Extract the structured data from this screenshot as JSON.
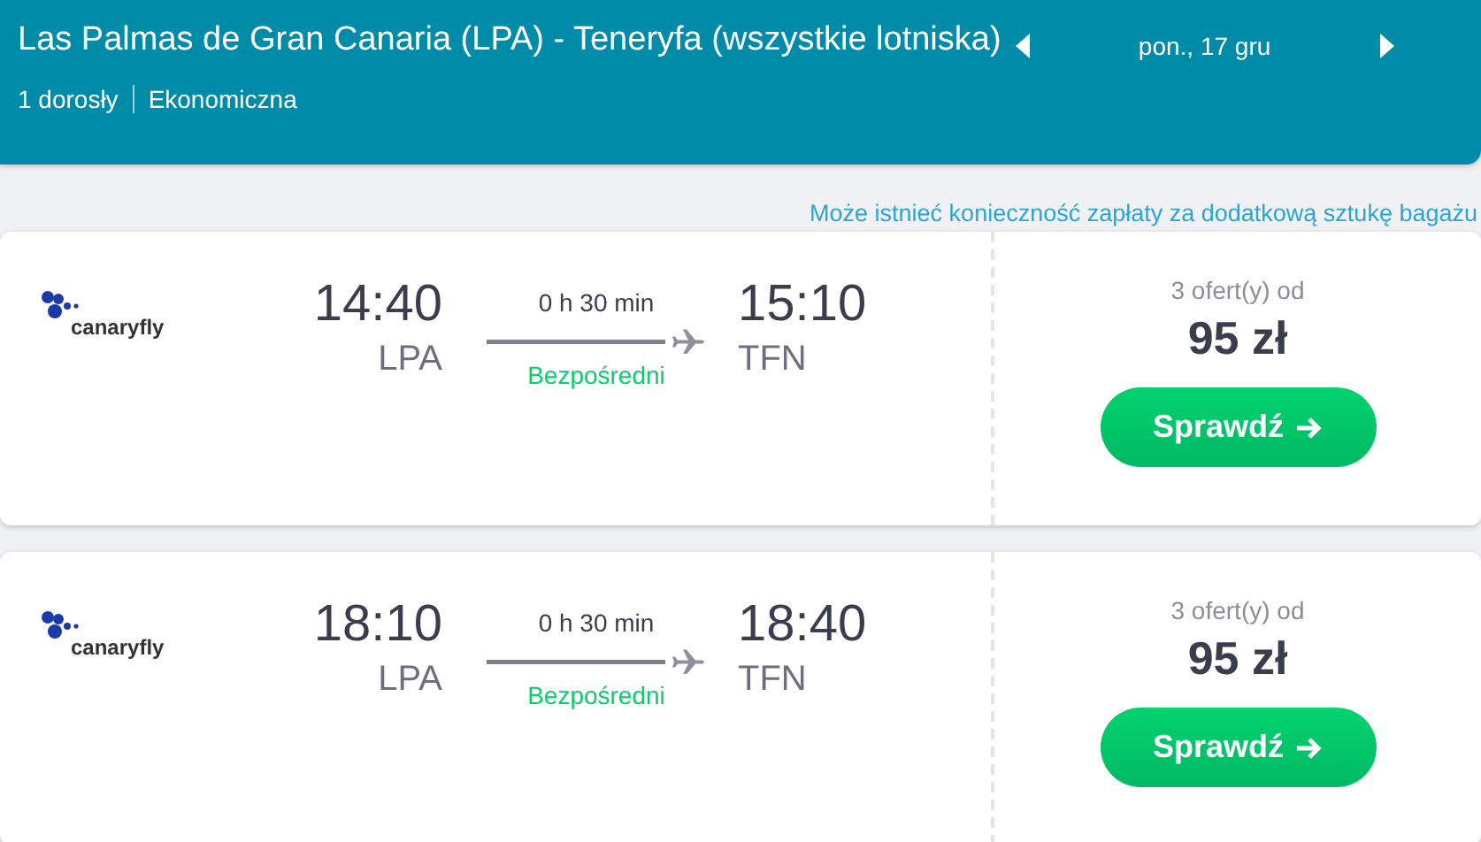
{
  "header": {
    "route": "Las Palmas de Gran Canaria (LPA) - Teneryfa (wszystkie lotniska)",
    "passengers": "1 dorosły",
    "cabin": "Ekonomiczna",
    "date": "pon., 17 gru"
  },
  "notice": "Może istnieć konieczność zapłaty za dodatkową sztukę bagażu",
  "flights": [
    {
      "airline": "canaryfly",
      "depart_time": "14:40",
      "depart_airport": "LPA",
      "duration": "0 h 30 min",
      "stops": "Bezpośredni",
      "arrive_time": "15:10",
      "arrive_airport": "TFN",
      "offers": "3 ofert(y) od",
      "price": "95 zł",
      "button": "Sprawdź"
    },
    {
      "airline": "canaryfly",
      "depart_time": "18:10",
      "depart_airport": "LPA",
      "duration": "0 h 30 min",
      "stops": "Bezpośredni",
      "arrive_time": "18:40",
      "arrive_airport": "TFN",
      "offers": "3 ofert(y) od",
      "price": "95 zł",
      "button": "Sprawdź"
    }
  ]
}
